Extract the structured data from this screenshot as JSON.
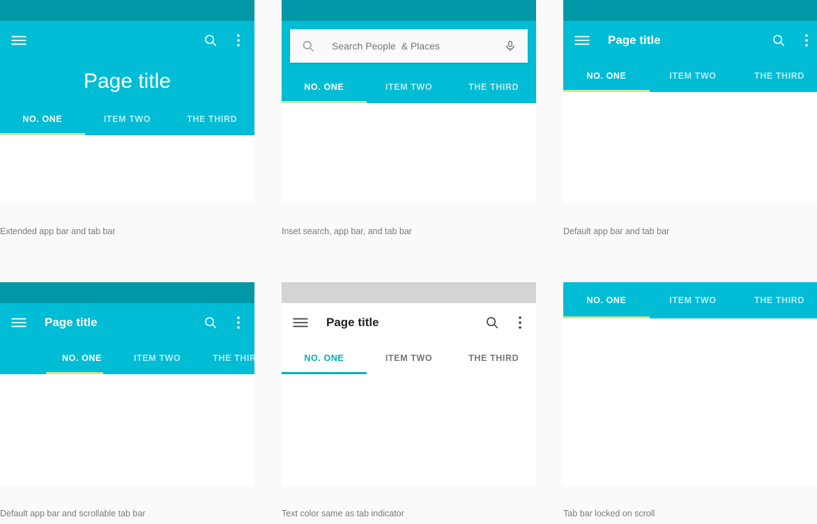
{
  "theme": {
    "primary": "#00bcd4",
    "primary_dark": "#0097a7",
    "indicator_yellow": "#d8e08a",
    "indicator_teal": "#00acc1",
    "page_background": "#fafafa",
    "caption_color": "#7a7a7a",
    "status_bar_gray": "#d4d4d4"
  },
  "common": {
    "page_title": "Page title",
    "tabs": [
      "NO. ONE",
      "ITEM TWO",
      "THE THIRD"
    ],
    "active_tab_index": 0,
    "icons": {
      "menu": "hamburger-menu-icon",
      "search": "search-icon",
      "more": "more-vert-icon",
      "mic": "microphone-icon"
    }
  },
  "panels": [
    {
      "id": "extended-app-bar",
      "caption": "Extended app bar and tab bar",
      "title": "Page title",
      "tabs": [
        "NO. ONE",
        "ITEM TWO",
        "THE THIRD"
      ],
      "active_tab": "NO. ONE",
      "status_bar": "teal",
      "app_bar_style": "teal-extended",
      "indicator_color": "#d8e08a"
    },
    {
      "id": "inset-search",
      "caption": "Inset search, app bar, and tab bar",
      "search_placeholder": "Search People  & Places",
      "search_value": "",
      "tabs": [
        "NO. ONE",
        "ITEM TWO",
        "THE THIRD"
      ],
      "active_tab": "NO. ONE",
      "status_bar": "teal",
      "app_bar_style": "teal-search",
      "indicator_color": "#d8e08a"
    },
    {
      "id": "default-app-bar",
      "caption": "Default app bar and tab bar",
      "title": "Page title",
      "tabs": [
        "NO. ONE",
        "ITEM TWO",
        "THE THIRD"
      ],
      "active_tab": "NO. ONE",
      "status_bar": "teal",
      "app_bar_style": "teal-default",
      "indicator_color": "#d8e08a"
    },
    {
      "id": "scrollable-tab-bar",
      "caption": "Default app bar and scrollable tab bar",
      "title": "Page title",
      "tabs": [
        "NO. ONE",
        "ITEM TWO",
        "THE THIRD"
      ],
      "active_tab": "NO. ONE",
      "status_bar": "teal",
      "app_bar_style": "teal-default",
      "indicator_color": "#d8e08a"
    },
    {
      "id": "text-color-same-as-indicator",
      "caption": "Text color same as tab indicator",
      "title": "Page title",
      "tabs": [
        "NO. ONE",
        "ITEM TWO",
        "THE THIRD"
      ],
      "active_tab": "NO. ONE",
      "status_bar": "gray",
      "app_bar_style": "white-default",
      "indicator_color": "#00acc1"
    },
    {
      "id": "tab-bar-locked-on-scroll",
      "caption": "Tab bar locked on scroll",
      "tabs": [
        "NO. ONE",
        "ITEM TWO",
        "THE THIRD"
      ],
      "active_tab": "NO. ONE",
      "status_bar": "none",
      "app_bar_style": "tabs-only",
      "indicator_color": "#d8e08a"
    }
  ]
}
